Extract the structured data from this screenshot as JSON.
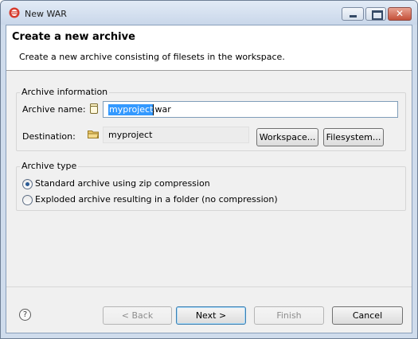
{
  "window": {
    "title": "New WAR",
    "close_glyph": "✕"
  },
  "header": {
    "title": "Create a new archive",
    "description": "Create a new archive consisting of filesets in the workspace."
  },
  "archive_info": {
    "legend": "Archive information",
    "name_label": "Archive name:",
    "name_selected": "myproject",
    "name_rest": ".war",
    "destination_label": "Destination:",
    "destination_value": "myproject",
    "workspace_button": "Workspace...",
    "filesystem_button": "Filesystem..."
  },
  "archive_type": {
    "legend": "Archive type",
    "options": [
      {
        "label": "Standard archive using zip compression",
        "checked": true
      },
      {
        "label": "Exploded archive resulting in a folder (no compression)",
        "checked": false
      }
    ]
  },
  "footer": {
    "help_glyph": "?",
    "back": "< Back",
    "next": "Next >",
    "finish": "Finish",
    "cancel": "Cancel"
  },
  "icons": {
    "app": "eclipse-icon",
    "name_field": "jar-icon",
    "destination": "folder-icon",
    "help": "help-icon"
  }
}
